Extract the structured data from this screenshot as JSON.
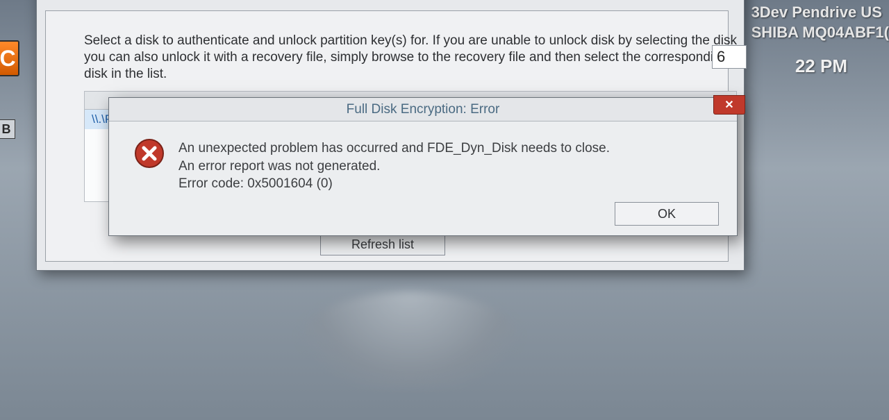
{
  "desktop": {
    "item1": "3Dev Pendrive US",
    "item2": "SHIBA MQ04ABF1(",
    "clock": "22 PM"
  },
  "left_icons": {
    "c": "C",
    "b": "B"
  },
  "parent_dialog": {
    "instructions": "Select a disk to authenticate and unlock partition key(s) for. If you are unable to unlock disk by selecting the disk you can also unlock it with a recovery file, simply browse to the recovery file and then select the corresponding disk in the list.",
    "input_value": "6",
    "disk_row_label": "\\\\.\\Phy",
    "refresh_label": "Refresh list"
  },
  "error_dialog": {
    "title": "Full Disk Encryption: Error",
    "close_label": "✕",
    "line1": "An unexpected problem has occurred and FDE_Dyn_Disk needs to close.",
    "line2": "An error report was not generated.",
    "line3": "Error code: 0x5001604 (0)",
    "ok_label": "OK"
  }
}
